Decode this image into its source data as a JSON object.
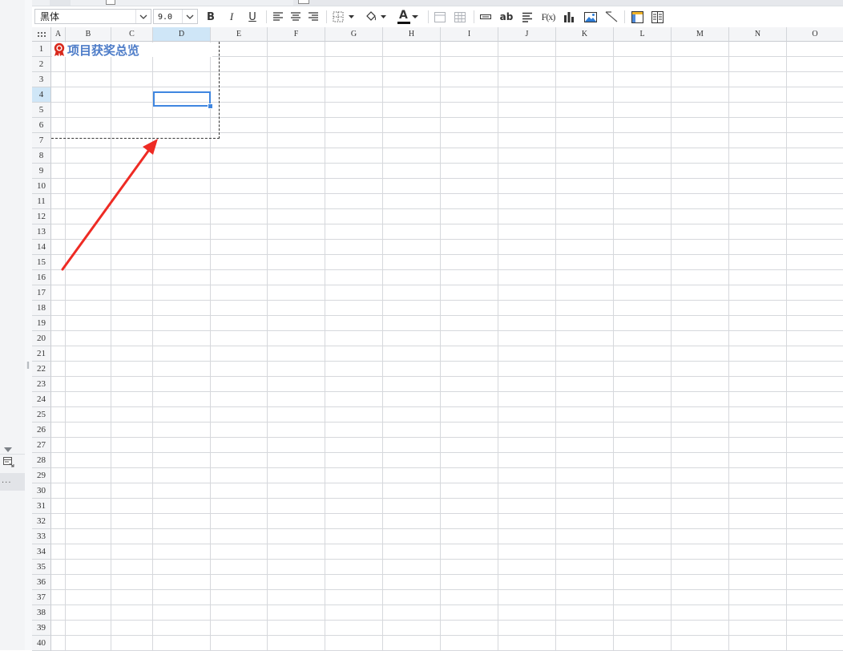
{
  "toolbar": {
    "font_name": "黑体",
    "font_size": "9.0",
    "bold": "B",
    "italic": "I",
    "underline": "U",
    "font_color_glyph": "A",
    "ab_label": "ab",
    "fx_label": "F(x)"
  },
  "sheet": {
    "columns": [
      "A",
      "B",
      "C",
      "D",
      "E",
      "F",
      "G",
      "H",
      "I",
      "J",
      "K",
      "L",
      "M",
      "N",
      "O"
    ],
    "selected_column": "D",
    "rows": [
      "1",
      "2",
      "3",
      "4",
      "5",
      "6",
      "7",
      "8",
      "9",
      "10",
      "11",
      "12",
      "13",
      "14",
      "15",
      "16",
      "17",
      "18",
      "19",
      "20",
      "21",
      "22",
      "23",
      "24",
      "25",
      "26",
      "27",
      "28",
      "29",
      "30",
      "31",
      "32",
      "33",
      "34",
      "35",
      "36",
      "37",
      "38",
      "39",
      "40"
    ],
    "selected_row": "4",
    "title_cell_text": "项目获奖总览"
  },
  "sidebar": {
    "more_label": "..."
  },
  "colors": {
    "title_text": "#4d7cc8",
    "selection": "#3f86e0",
    "header_selected": "#cfe6f7",
    "annotation_arrow": "#ee2b24",
    "award_icon": "#d9291c"
  }
}
